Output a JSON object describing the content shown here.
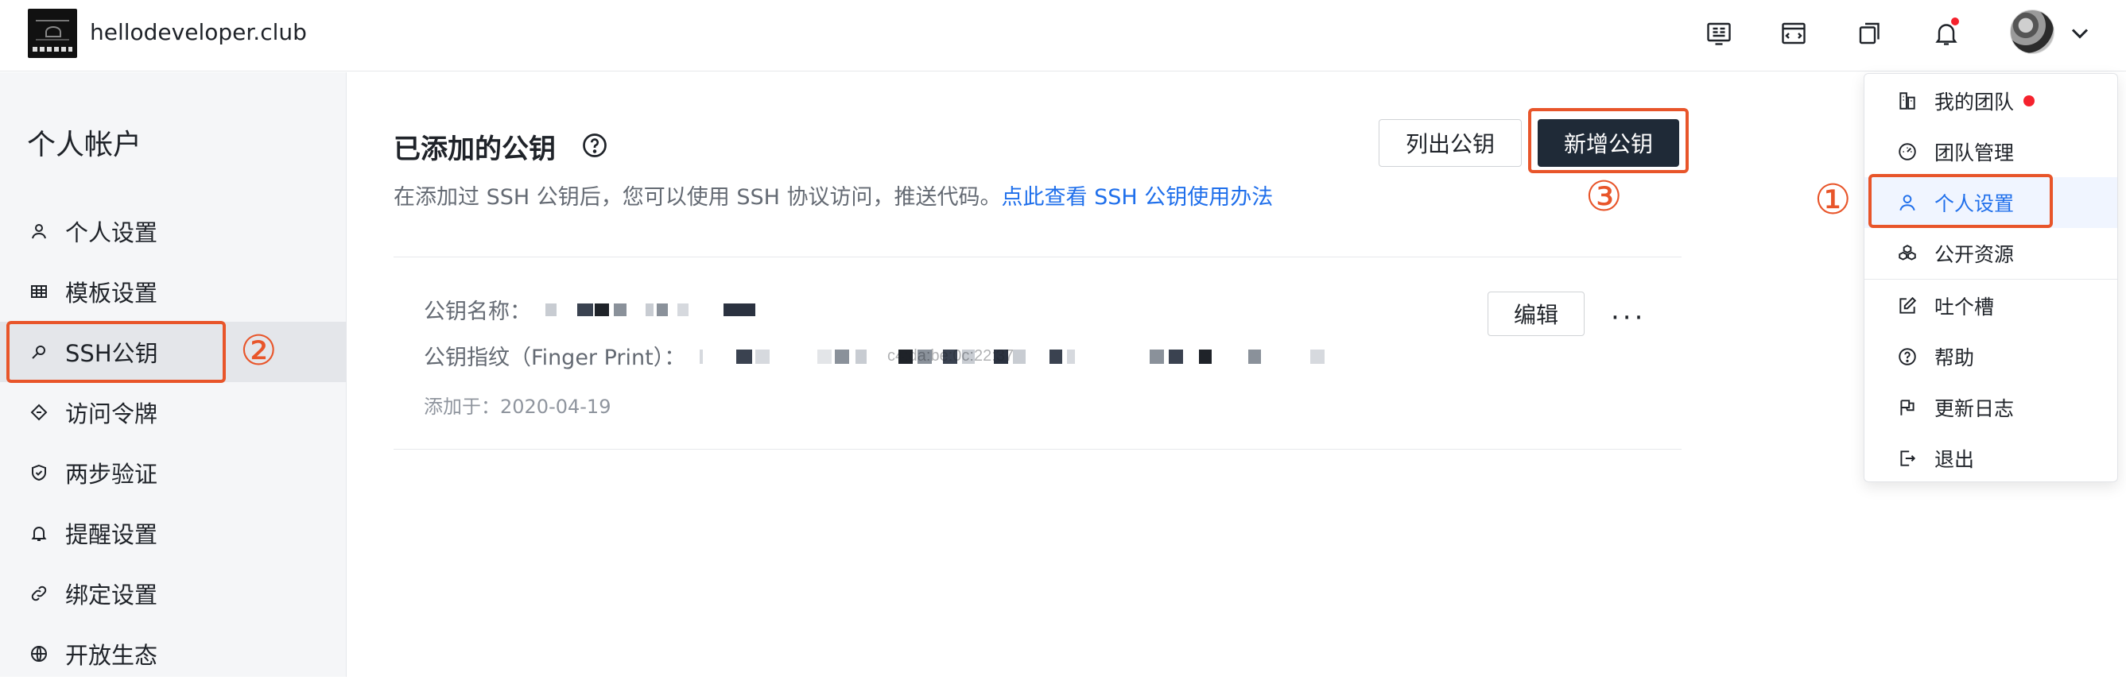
{
  "header": {
    "site_name": "hellodeveloper.club",
    "icons": [
      "book-icon",
      "calendar-window-icon",
      "copy-icon",
      "bell-icon",
      "avatar",
      "chevron-down-icon"
    ]
  },
  "sidebar": {
    "title": "个人帐户",
    "items": [
      {
        "label": "个人设置",
        "icon": "user-icon"
      },
      {
        "label": "模板设置",
        "icon": "table-icon"
      },
      {
        "label": "SSH公钥",
        "icon": "key-icon"
      },
      {
        "label": "访问令牌",
        "icon": "ticket-icon"
      },
      {
        "label": "两步验证",
        "icon": "shield-icon"
      },
      {
        "label": "提醒设置",
        "icon": "bell-icon"
      },
      {
        "label": "绑定设置",
        "icon": "link-icon"
      },
      {
        "label": "开放生态",
        "icon": "globe-icon"
      }
    ],
    "active_index": 2
  },
  "main": {
    "title": "已添加的公钥",
    "description": "在添加过 SSH 公钥后，您可以使用 SSH 协议访问，推送代码。",
    "description_link": "点此查看 SSH 公钥使用办法",
    "list_button": "列出公钥",
    "add_button": "新增公钥",
    "key": {
      "name_label": "公钥名称：",
      "fingerprint_label": "公钥指纹（Finger Print）：",
      "fingerprint_visible_fragment": "c4:da:be:0c:22:37",
      "added_label": "添加于：2020-04-19",
      "edit_button": "编辑",
      "more_label": "···"
    }
  },
  "dropdown": {
    "items": [
      {
        "label": "我的团队",
        "icon": "team-icon",
        "dot": true
      },
      {
        "label": "团队管理",
        "icon": "dashboard-icon"
      },
      {
        "label": "个人设置",
        "icon": "user-icon",
        "active": true
      },
      {
        "label": "公开资源",
        "icon": "cubes-icon"
      },
      {
        "label": "吐个槽",
        "icon": "edit-icon"
      },
      {
        "label": "帮助",
        "icon": "help-icon"
      },
      {
        "label": "更新日志",
        "icon": "flag-icon"
      },
      {
        "label": "退出",
        "icon": "logout-icon"
      }
    ]
  },
  "annotations": {
    "step1": "①",
    "step2": "②",
    "step3": "③",
    "color": "#e8552a"
  },
  "colors": {
    "accent_link": "#1f6feb",
    "dark_button": "#1f2a37",
    "notification_dot": "#f5222d"
  }
}
